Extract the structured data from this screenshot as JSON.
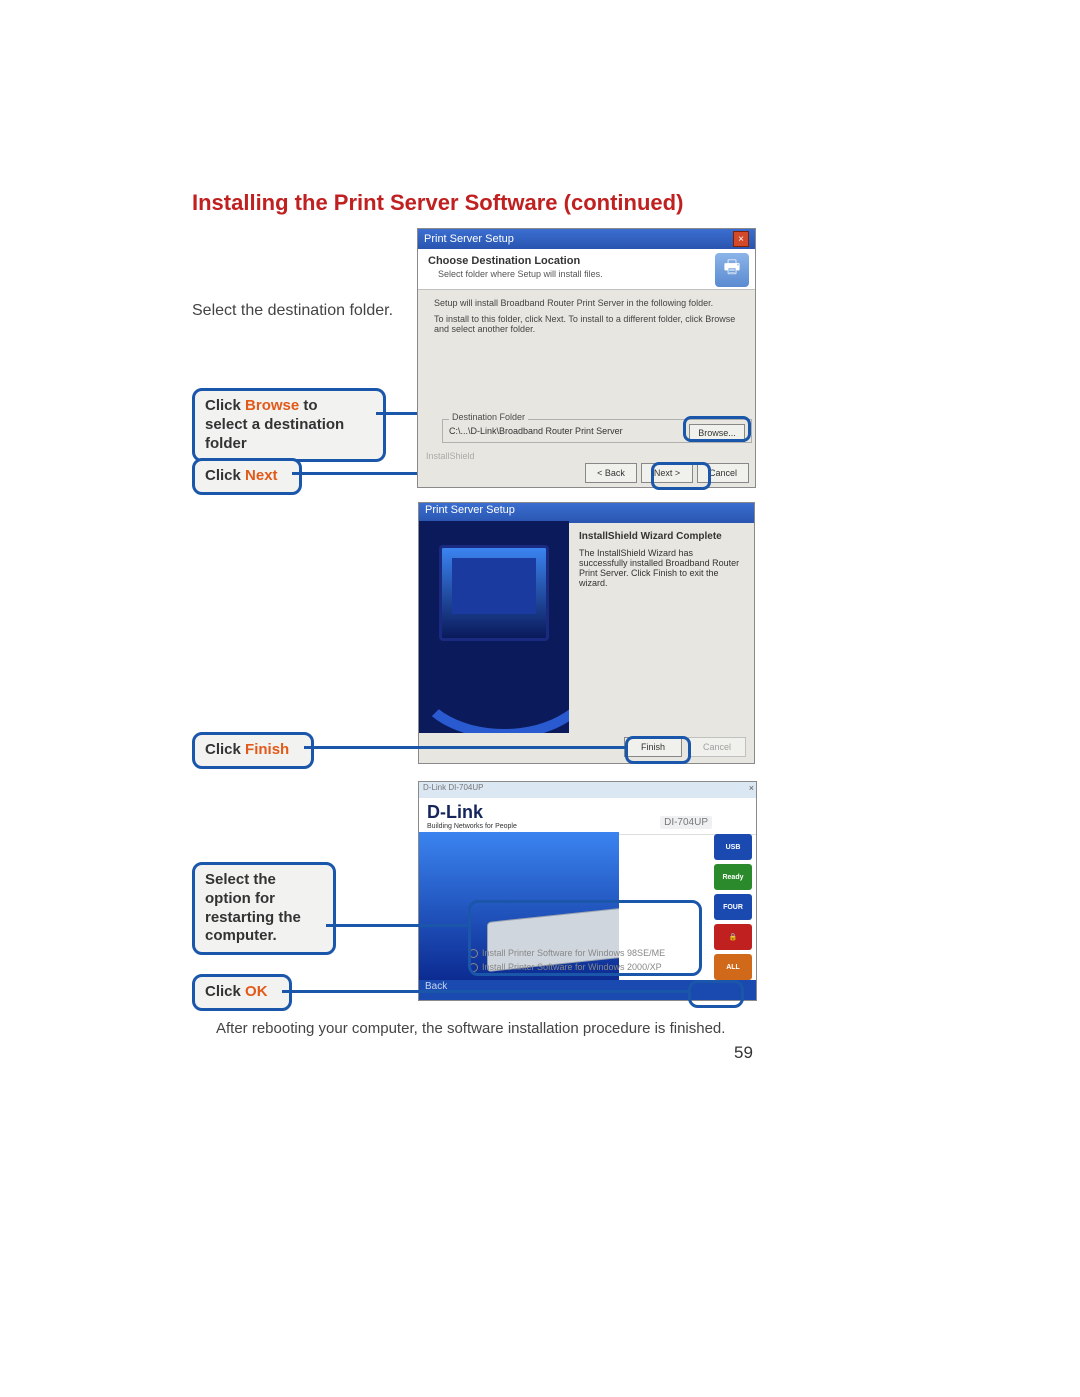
{
  "title": "Installing the Print Server Software (continued)",
  "instruction1": "Select the destination folder.",
  "callouts": {
    "browse_line1_a": "Click ",
    "browse_line1_b": "Browse",
    "browse_line1_c": " to",
    "browse_line2": "select a destination",
    "browse_line3": "folder",
    "next_a": "Click ",
    "next_b": "Next",
    "finish_a": "Click ",
    "finish_b": "Finish",
    "select_l1": "Select the",
    "select_l2": "option for",
    "select_l3": "restarting the",
    "select_l4": "computer.",
    "ok_a": "Click ",
    "ok_b": "OK"
  },
  "shot1": {
    "titlebar": "Print Server Setup",
    "header_h1": "Choose Destination Location",
    "header_sub": "Select folder where Setup will install files.",
    "body_l1": "Setup will install Broadband Router Print Server in the following folder.",
    "body_l2": "To install to this folder, click Next. To install to a different folder, click Browse and select another folder.",
    "dest_label": "Destination Folder",
    "dest_path": "C:\\...\\D-Link\\Broadband Router Print Server",
    "browse_btn": "Browse...",
    "install_shield": "InstallShield",
    "btn_back": "< Back",
    "btn_next": "Next >",
    "btn_cancel": "Cancel"
  },
  "shot2": {
    "titlebar": "Print Server Setup",
    "heading": "InstallShield Wizard Complete",
    "text": "The InstallShield Wizard has successfully installed Broadband Router Print Server. Click Finish to exit the wizard.",
    "btn_finish": "Finish",
    "btn_cancel": "Cancel"
  },
  "shot3": {
    "top_text": "D-Link DI-704UP",
    "brand": "D-Link",
    "brand_sub": "Building Networks for People",
    "model": "DI-704UP",
    "badges": {
      "b1": "USB",
      "b2": "Ready",
      "b3": "FOUR",
      "b4": "🔒",
      "b5": "ALL"
    },
    "opt1": "Install Printer Software for Windows 98SE/ME",
    "opt2": "Install Printer Software for Windows 2000/XP",
    "back": "Back"
  },
  "footer_note": "After rebooting your computer, the software installation procedure is finished.",
  "page_number": "59"
}
